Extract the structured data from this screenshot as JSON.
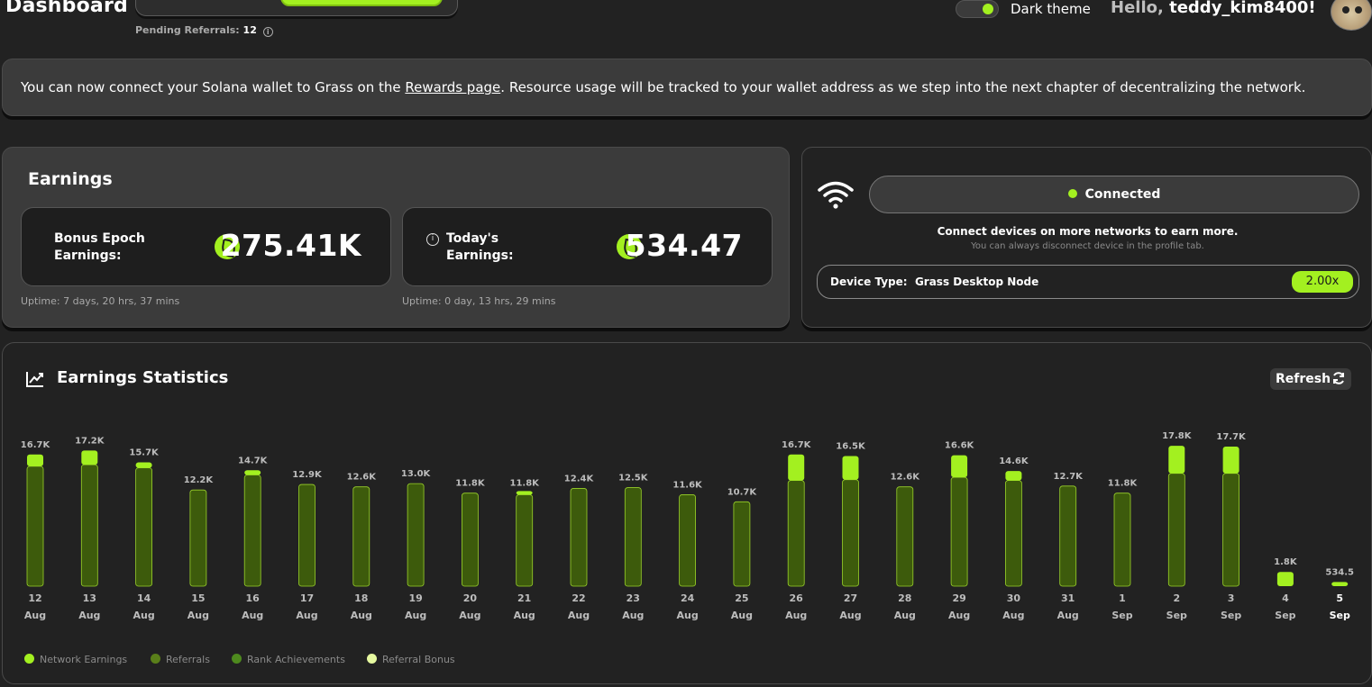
{
  "header": {
    "title": "Dashboard",
    "pending_label": "Pending Referrals:",
    "pending_count": "12",
    "theme_label": "Dark theme",
    "hello": "Hello,",
    "username": "teddy_kim8400!"
  },
  "announcement": {
    "before": "You can now connect your Solana wallet to Grass on the ",
    "link": "Rewards page",
    "after": ". Resource usage will be tracked to your wallet address as we step into the next chapter of decentralizing the network."
  },
  "earnings": {
    "title": "Earnings",
    "bonus_label_1": "Bonus Epoch",
    "bonus_label_2": "Earnings:",
    "bonus_value": "275.41K",
    "bonus_uptime": "Uptime: 7 days, 20 hrs, 37 mins",
    "today_label_1": "Today's",
    "today_label_2": "Earnings:",
    "today_value": "534.47",
    "today_uptime": "Uptime: 0 day, 13 hrs, 29 mins"
  },
  "connection": {
    "status": "Connected",
    "message": "Connect devices on more networks to earn more.",
    "sub": "You can always disconnect device in the profile tab.",
    "device_label": "Device Type:",
    "device_value": "Grass Desktop Node",
    "multiplier": "2.00x"
  },
  "stats": {
    "title": "Earnings Statistics",
    "refresh": "Refresh",
    "legend": [
      {
        "name": "Network Earnings",
        "color": "#a3f020"
      },
      {
        "name": "Referrals",
        "color": "#5a7f1a"
      },
      {
        "name": "Rank Achievements",
        "color": "#4e8a1e"
      },
      {
        "name": "Referral Bonus",
        "color": "#e6f9a0"
      }
    ]
  },
  "colors": {
    "accent": "#a3f020",
    "bar_dark": "#3d5b0c"
  },
  "chart_data": {
    "type": "bar",
    "categories": [
      "12 Aug",
      "13 Aug",
      "14 Aug",
      "15 Aug",
      "16 Aug",
      "17 Aug",
      "18 Aug",
      "19 Aug",
      "20 Aug",
      "21 Aug",
      "22 Aug",
      "23 Aug",
      "24 Aug",
      "25 Aug",
      "26 Aug",
      "27 Aug",
      "28 Aug",
      "29 Aug",
      "30 Aug",
      "31 Aug",
      "1 Sep",
      "2 Sep",
      "3 Sep",
      "4 Sep",
      "5 Sep"
    ],
    "day_labels": [
      "12",
      "13",
      "14",
      "15",
      "16",
      "17",
      "18",
      "19",
      "20",
      "21",
      "22",
      "23",
      "24",
      "25",
      "26",
      "27",
      "28",
      "29",
      "30",
      "31",
      "1",
      "2",
      "3",
      "4",
      "5"
    ],
    "month_labels": [
      "Aug",
      "Aug",
      "Aug",
      "Aug",
      "Aug",
      "Aug",
      "Aug",
      "Aug",
      "Aug",
      "Aug",
      "Aug",
      "Aug",
      "Aug",
      "Aug",
      "Aug",
      "Aug",
      "Aug",
      "Aug",
      "Aug",
      "Aug",
      "Sep",
      "Sep",
      "Sep",
      "Sep",
      "Sep"
    ],
    "total_labels": [
      "16.7K",
      "17.2K",
      "15.7K",
      "12.2K",
      "14.7K",
      "12.9K",
      "12.6K",
      "13.0K",
      "11.8K",
      "11.8K",
      "12.4K",
      "12.5K",
      "11.6K",
      "10.7K",
      "16.7K",
      "16.5K",
      "12.6K",
      "16.6K",
      "14.6K",
      "12.7K",
      "11.8K",
      "17.8K",
      "17.7K",
      "1.8K",
      "534.5"
    ],
    "series": [
      {
        "name": "Network Earnings",
        "values": [
          1500,
          1800,
          700,
          0,
          600,
          0,
          0,
          0,
          0,
          200,
          0,
          0,
          0,
          0,
          3300,
          3000,
          0,
          2800,
          1200,
          0,
          0,
          3500,
          3400,
          1800,
          534.5
        ]
      },
      {
        "name": "Referrals",
        "values": [
          15200,
          15400,
          15000,
          12200,
          14100,
          12900,
          12600,
          13000,
          11800,
          11600,
          12400,
          12500,
          11600,
          10700,
          13400,
          13500,
          12600,
          13800,
          13400,
          12700,
          11800,
          14300,
          14300,
          0,
          0
        ]
      }
    ],
    "ylim": [
      0,
      18500
    ],
    "highlight_index": 24
  }
}
